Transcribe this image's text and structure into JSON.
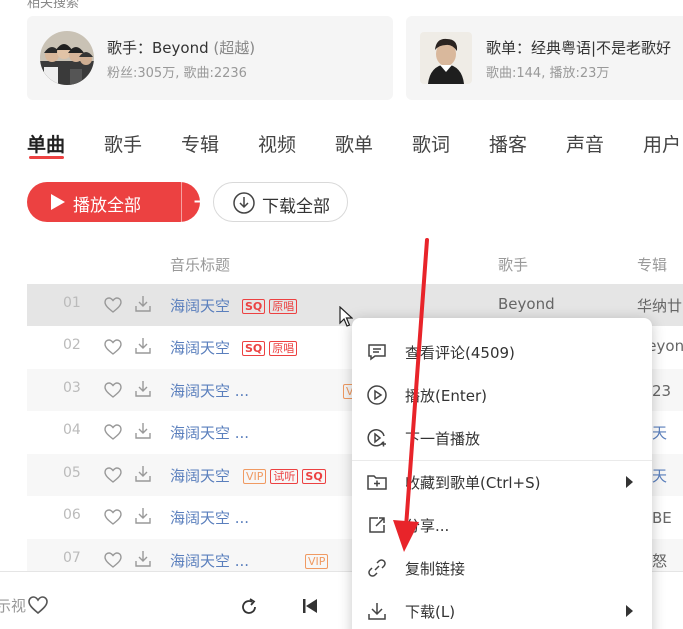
{
  "header": {
    "cut_text": "相关搜索"
  },
  "cards": [
    {
      "title_prefix": "歌手：",
      "title_name": "Beyond",
      "title_alias": "(超越)",
      "subtitle": "粉丝:305万, 歌曲:2236"
    },
    {
      "title": "歌单：经典粤语|不是老歌好",
      "subtitle": "歌曲:144, 播放:23万"
    }
  ],
  "tabs": [
    "单曲",
    "歌手",
    "专辑",
    "视频",
    "歌单",
    "歌词",
    "播客",
    "声音",
    "用户"
  ],
  "actions": {
    "play_all": "播放全部",
    "plus": "+",
    "download_all": "下载全部"
  },
  "table": {
    "headers": {
      "title": "音乐标题",
      "artist": "歌手",
      "album": "专辑"
    },
    "rows": [
      {
        "num": "01",
        "name": "海阔天空",
        "tags": [
          "SQ",
          "原唱"
        ],
        "artist": "Beyond",
        "album": "华纳廿"
      },
      {
        "num": "02",
        "name": "海阔天空",
        "tags": [
          "SQ",
          "原唱"
        ],
        "artist": "",
        "album": "Beyon"
      },
      {
        "num": "03",
        "name": "海阔天空 ...",
        "tags": [
          "VIP"
        ],
        "artist": "",
        "album": "纳23"
      },
      {
        "num": "04",
        "name": "海阔天空 ...",
        "tags": [],
        "artist": "",
        "album": "阔天"
      },
      {
        "num": "05",
        "name": "海阔天空",
        "tags": [
          "VIP",
          "试听",
          "SQ"
        ],
        "artist": "",
        "album": "阔天"
      },
      {
        "num": "06",
        "name": "海阔天空 ...",
        "tags": [],
        "artist": "",
        "album": "越BE"
      },
      {
        "num": "07",
        "name": "海阔天空 ...",
        "tags": [
          "VIP"
        ],
        "artist": "",
        "album": "与怒"
      }
    ]
  },
  "player": {
    "cut_text": "示视"
  },
  "context_menu": [
    {
      "label": "查看评论(4509)",
      "icon": "comment-icon"
    },
    {
      "label": "播放(Enter)",
      "icon": "play-circle-icon"
    },
    {
      "label": "下一首播放",
      "icon": "next-play-icon"
    },
    {
      "label": "收藏到歌单(Ctrl+S)",
      "icon": "add-folder-icon",
      "submenu": true
    },
    {
      "label": "分享...",
      "icon": "share-icon"
    },
    {
      "label": "复制链接",
      "icon": "link-icon"
    },
    {
      "label": "下载(L)",
      "icon": "download-icon",
      "submenu": true
    }
  ],
  "colors": {
    "accent": "#ec4141",
    "link": "#5a7fbd",
    "vip": "#f09a62",
    "annotation": "#e8242a"
  }
}
